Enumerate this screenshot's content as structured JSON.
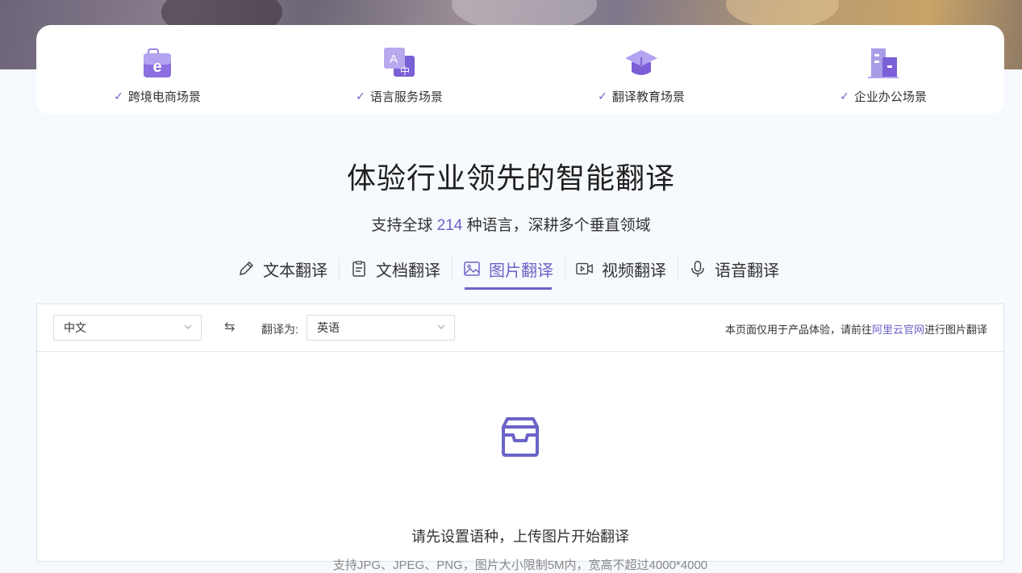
{
  "scenes": [
    {
      "label": "跨境电商场景",
      "icon": "ecommerce-bag-icon"
    },
    {
      "label": "语言服务场景",
      "icon": "language-translate-icon"
    },
    {
      "label": "翻译教育场景",
      "icon": "graduation-cap-icon"
    },
    {
      "label": "企业办公场景",
      "icon": "office-building-icon"
    }
  ],
  "check_glyph": "✓",
  "title": "体验行业领先的智能翻译",
  "subtitle": {
    "prefix": "支持全球 ",
    "count": "214",
    "suffix": " 种语言，深耕多个垂直领域"
  },
  "tabs": [
    {
      "label": "文本翻译",
      "icon": "pencil-icon",
      "active": false
    },
    {
      "label": "文档翻译",
      "icon": "document-icon",
      "active": false
    },
    {
      "label": "图片翻译",
      "icon": "image-icon",
      "active": true
    },
    {
      "label": "视频翻译",
      "icon": "video-icon",
      "active": false
    },
    {
      "label": "语音翻译",
      "icon": "microphone-icon",
      "active": false
    }
  ],
  "toolbar": {
    "source_lang": "中文",
    "swap_glyph": "⇆",
    "target_label": "翻译为:",
    "target_lang": "英语",
    "notice_prefix": "本页面仅用于产品体验，请前往",
    "notice_link": "阿里云官网",
    "notice_suffix": "进行图片翻译"
  },
  "empty_state": {
    "message": "请先设置语种，上传图片开始翻译",
    "hint": "支持JPG、JPEG、PNG，图片大小限制5M内，宽高不超过4000*4000"
  },
  "colors": {
    "accent": "#6b63c8",
    "page_bg": "#f6f9fd",
    "icon_purple": "#7a5fd6"
  }
}
